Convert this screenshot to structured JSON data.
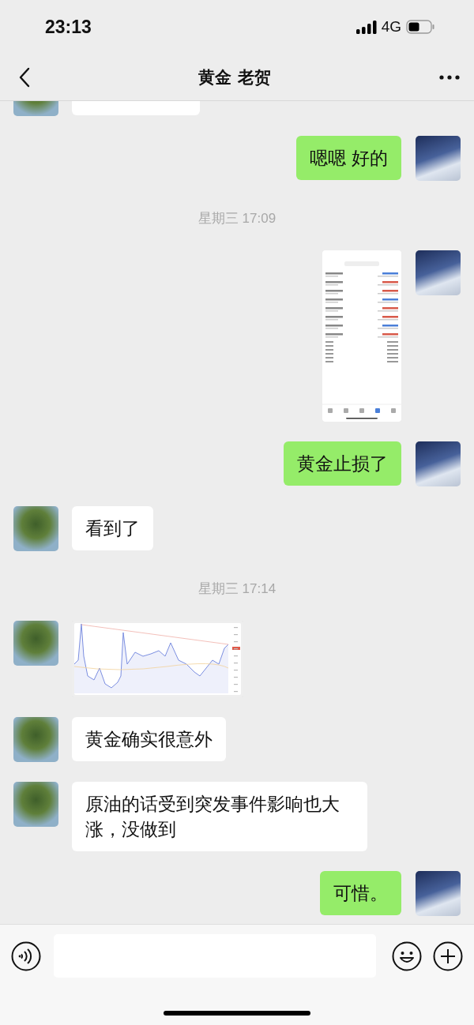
{
  "status_bar": {
    "time": "23:13",
    "network": "4G"
  },
  "nav": {
    "title": "黄金 老贺"
  },
  "messages": [
    {
      "kind": "cut",
      "outgoing": false
    },
    {
      "kind": "text",
      "outgoing": true,
      "text": "嗯嗯 好的"
    },
    {
      "kind": "time",
      "text": "星期三 17:09"
    },
    {
      "kind": "screenshot",
      "outgoing": true
    },
    {
      "kind": "text",
      "outgoing": true,
      "text": "黄金止损了"
    },
    {
      "kind": "text",
      "outgoing": false,
      "text": "看到了"
    },
    {
      "kind": "time",
      "text": "星期三 17:14"
    },
    {
      "kind": "chart",
      "outgoing": false
    },
    {
      "kind": "text",
      "outgoing": false,
      "text": "黄金确实很意外"
    },
    {
      "kind": "text",
      "outgoing": false,
      "text": "原油的话受到突发事件影响也大涨，没做到"
    },
    {
      "kind": "text",
      "outgoing": true,
      "text": "可惜。"
    }
  ]
}
